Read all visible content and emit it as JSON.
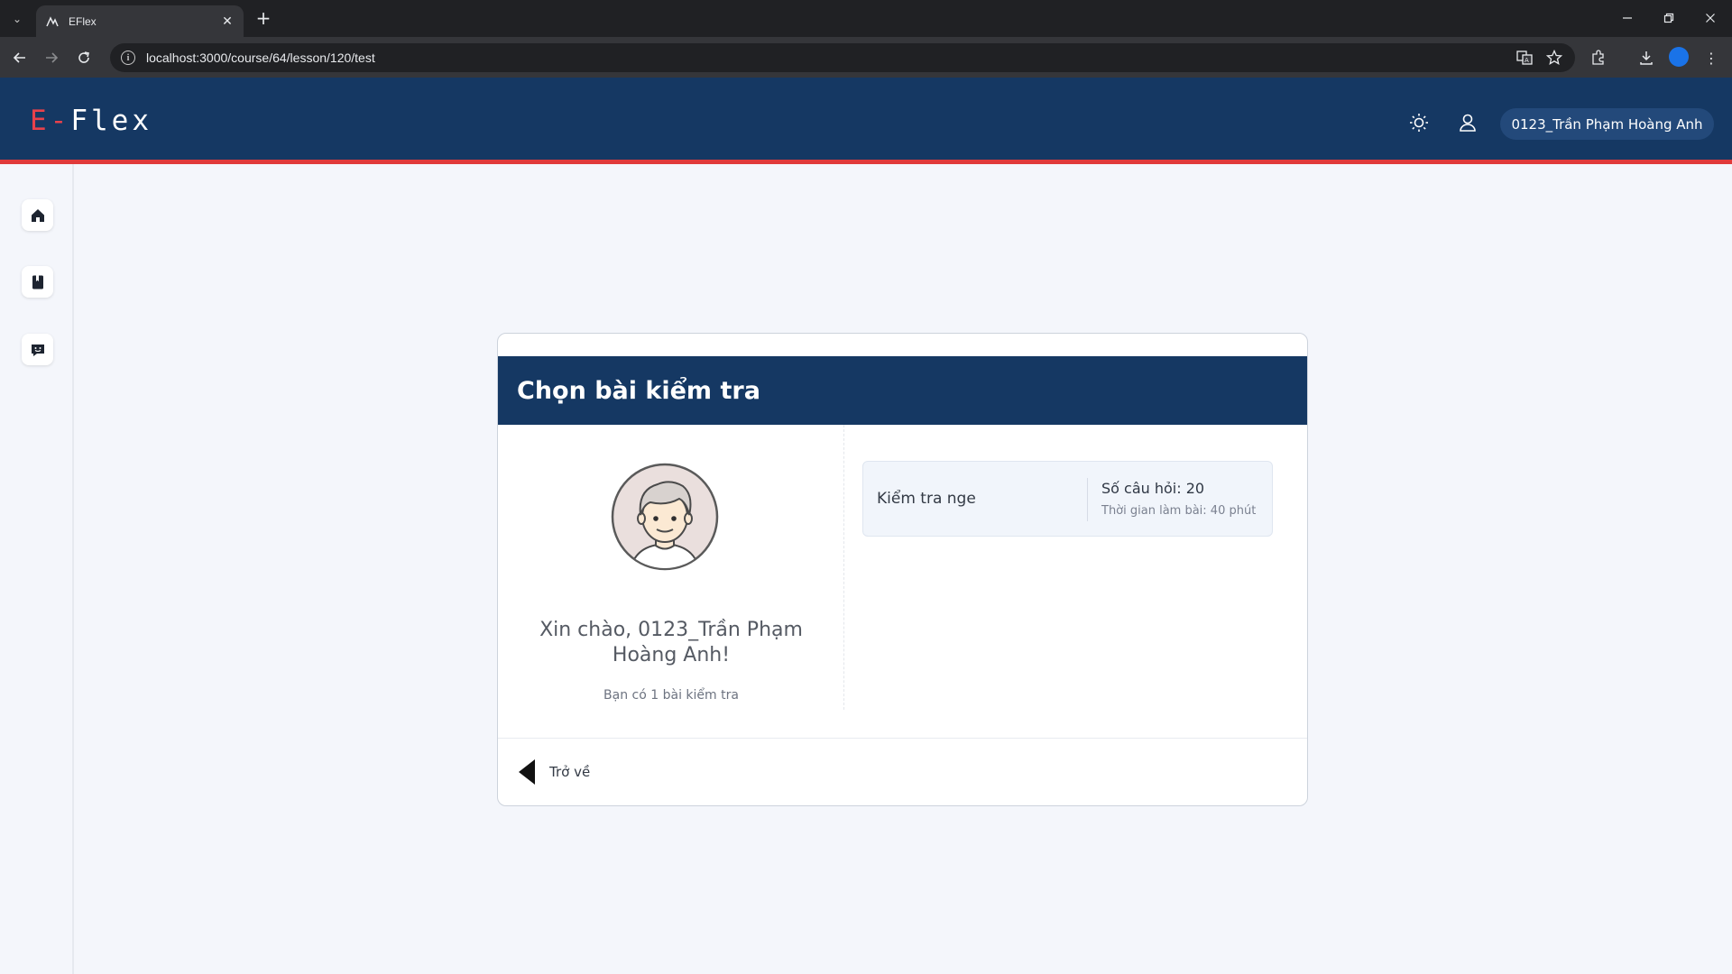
{
  "browser": {
    "tab_title": "EFlex",
    "url": "localhost:3000/course/64/lesson/120/test"
  },
  "header": {
    "logo_prefix": "E-",
    "logo_text": "Flex",
    "user_name": "0123_Trần Phạm Hoàng Anh"
  },
  "sidebar": {
    "items": [
      {
        "name": "home",
        "icon": "home-icon"
      },
      {
        "name": "courses",
        "icon": "book-icon"
      },
      {
        "name": "chat",
        "icon": "chat-icon"
      }
    ]
  },
  "card": {
    "title": "Chọn bài kiểm tra",
    "greeting": "Xin chào, 0123_Trần Phạm Hoàng Anh!",
    "subtitle": "Bạn có 1 bài kiểm tra",
    "tests": [
      {
        "name": "Kiểm tra nge",
        "question_count": "Số câu hỏi: 20",
        "duration": "Thời gian làm bài: 40 phút"
      }
    ],
    "back_label": "Trở về"
  },
  "colors": {
    "primary": "#153863",
    "accent": "#e03a3a"
  }
}
